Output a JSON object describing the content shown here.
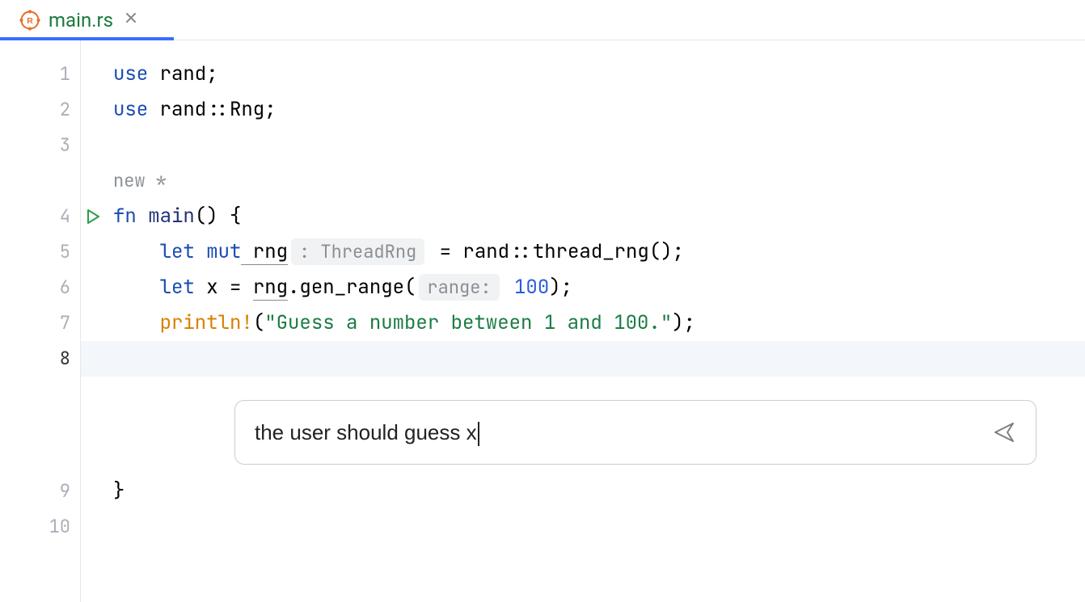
{
  "tab": {
    "filename": "main.rs",
    "icon": "rust-icon",
    "close_label": "×"
  },
  "gutter": {
    "lines": [
      "1",
      "2",
      "3",
      "",
      "4",
      "5",
      "6",
      "7",
      "8",
      "9",
      "10"
    ],
    "run_line_index": 4,
    "current_line_index": 8
  },
  "code": {
    "l1_use": "use",
    "l1_rand": " rand;",
    "l2_use": "use",
    "l2_rest": " rand::Rng;",
    "lens_text": "new *",
    "l4_fn": "fn",
    "l4_main": " main",
    "l4_rest": "() {",
    "l5_let": "    let mut",
    "l5_rng": " rng",
    "l5_hint": ": ThreadRng",
    "l5_eq": " = rand::thread_rng();",
    "l6_let": "    let",
    "l6_x": " x = ",
    "l6_rng": "rng",
    "l6_gen": ".gen_range(",
    "l6_hint": "range:",
    "l6_num": " 100",
    "l6_close": ");",
    "l7_macro": "    println!",
    "l7_paren": "(",
    "l7_str": "\"Guess a number between 1 and 100.\"",
    "l7_close": ");",
    "l9_close": "}"
  },
  "prompt": {
    "text": "the user should guess x"
  },
  "colors": {
    "accent": "#3a6dff",
    "keyword": "#1b4db3",
    "string": "#1b7c44",
    "macro": "#d98100"
  }
}
